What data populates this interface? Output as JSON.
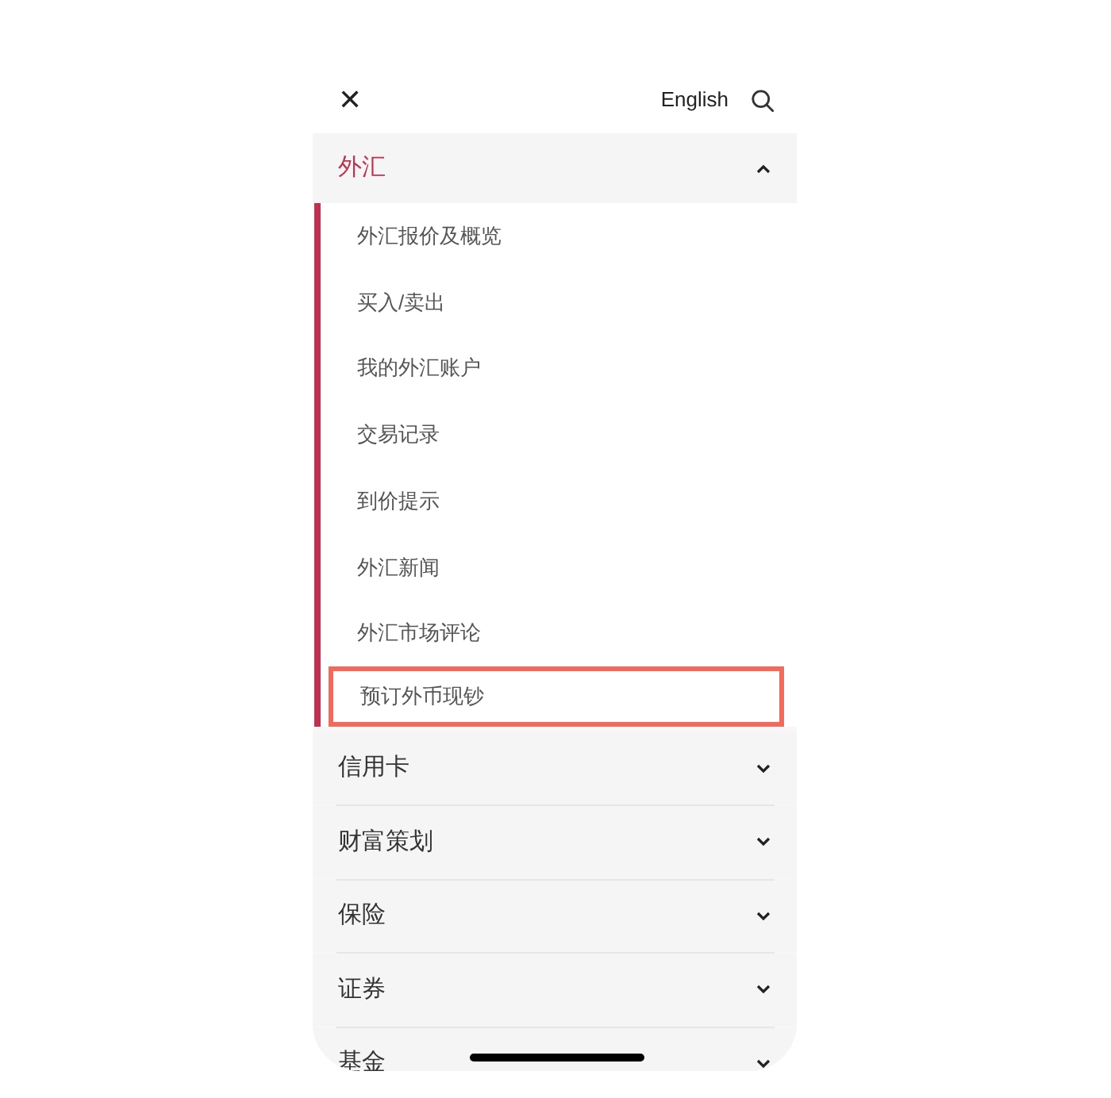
{
  "header": {
    "close_icon": "✕",
    "language": "English"
  },
  "sections": [
    {
      "label": "外汇",
      "expanded": true,
      "items": [
        {
          "label": "外汇报价及概览",
          "highlighted": false
        },
        {
          "label": "买入/卖出",
          "highlighted": false
        },
        {
          "label": "我的外汇账户",
          "highlighted": false
        },
        {
          "label": "交易记录",
          "highlighted": false
        },
        {
          "label": "到价提示",
          "highlighted": false
        },
        {
          "label": "外汇新闻",
          "highlighted": false
        },
        {
          "label": "外汇市场评论",
          "highlighted": false
        },
        {
          "label": "预订外币现钞",
          "highlighted": true
        }
      ]
    },
    {
      "label": "信用卡",
      "expanded": false
    },
    {
      "label": "财富策划",
      "expanded": false
    },
    {
      "label": "保险",
      "expanded": false
    },
    {
      "label": "证券",
      "expanded": false
    },
    {
      "label": "基金",
      "expanded": false
    }
  ]
}
